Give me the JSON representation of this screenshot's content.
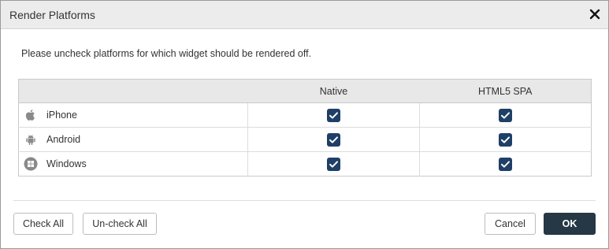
{
  "dialog": {
    "title": "Render Platforms",
    "instruction": "Please uncheck platforms for which widget should be rendered off."
  },
  "table": {
    "headers": [
      "",
      "Native",
      "HTML5 SPA"
    ],
    "rows": [
      {
        "platform": "iPhone",
        "icon": "apple-icon",
        "native": true,
        "html5_spa": true
      },
      {
        "platform": "Android",
        "icon": "android-icon",
        "native": true,
        "html5_spa": true
      },
      {
        "platform": "Windows",
        "icon": "windows-icon",
        "native": true,
        "html5_spa": true
      }
    ]
  },
  "buttons": {
    "check_all": "Check All",
    "uncheck_all": "Un-check All",
    "cancel": "Cancel",
    "ok": "OK"
  },
  "colors": {
    "checkbox": "#1f3f66",
    "primary_button": "#263845",
    "header_bg": "#e8e8e8",
    "titlebar_bg": "#ececec"
  }
}
